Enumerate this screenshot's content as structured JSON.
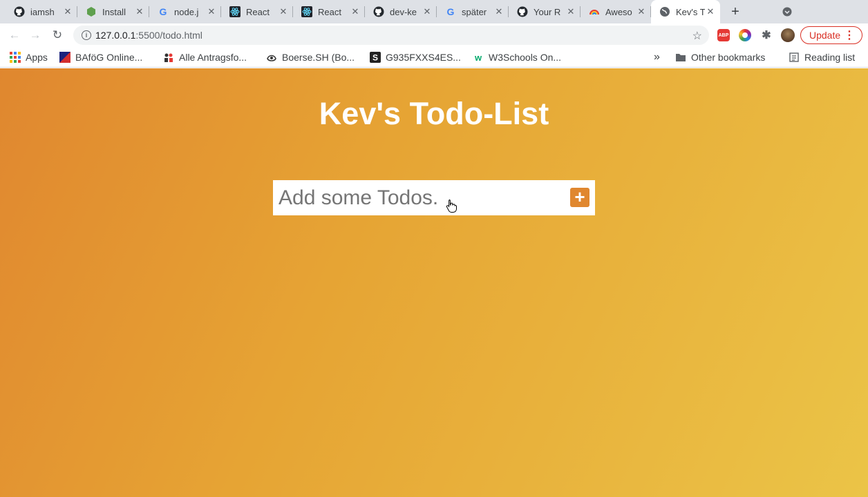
{
  "tabs": [
    {
      "title": "iamsh",
      "favicon": "github-icon"
    },
    {
      "title": "Install",
      "favicon": "nodejs-icon"
    },
    {
      "title": "node.j",
      "favicon": "google-icon"
    },
    {
      "title": "React",
      "favicon": "react-icon"
    },
    {
      "title": "React",
      "favicon": "react-icon"
    },
    {
      "title": "dev-ke",
      "favicon": "github-icon"
    },
    {
      "title": "später",
      "favicon": "google-icon"
    },
    {
      "title": "Your R",
      "favicon": "github-icon"
    },
    {
      "title": "Aweso",
      "favicon": "rainbow-icon"
    },
    {
      "title": "Kev's T",
      "favicon": "globe-icon",
      "active": true
    }
  ],
  "toolbar": {
    "url_host": "127.0.0.1",
    "url_path": ":5500/todo.html",
    "update_label": "Update",
    "abp_label": "ABP"
  },
  "bookmarks": {
    "items": [
      {
        "label": "Apps",
        "icon": "apps-grid-icon"
      },
      {
        "label": "BAföG Online...",
        "icon": "bafog-icon"
      },
      {
        "label": "Alle Antragsfo...",
        "icon": "people-icon"
      },
      {
        "label": "Boerse.SH (Bo...",
        "icon": "boerse-icon"
      },
      {
        "label": "G935FXXS4ES...",
        "icon": "samsung-icon"
      },
      {
        "label": "W3Schools On...",
        "icon": "w3schools-icon"
      }
    ],
    "overflow": "»",
    "other": "Other bookmarks",
    "reading_list": "Reading list"
  },
  "page": {
    "title": "Kev's Todo-List",
    "input_placeholder": "Add some Todos.",
    "input_value": ""
  },
  "colors": {
    "gradient_start": "#e0872f",
    "gradient_end": "#ebc447",
    "add_button": "#e0872f",
    "update_red": "#d93025"
  }
}
